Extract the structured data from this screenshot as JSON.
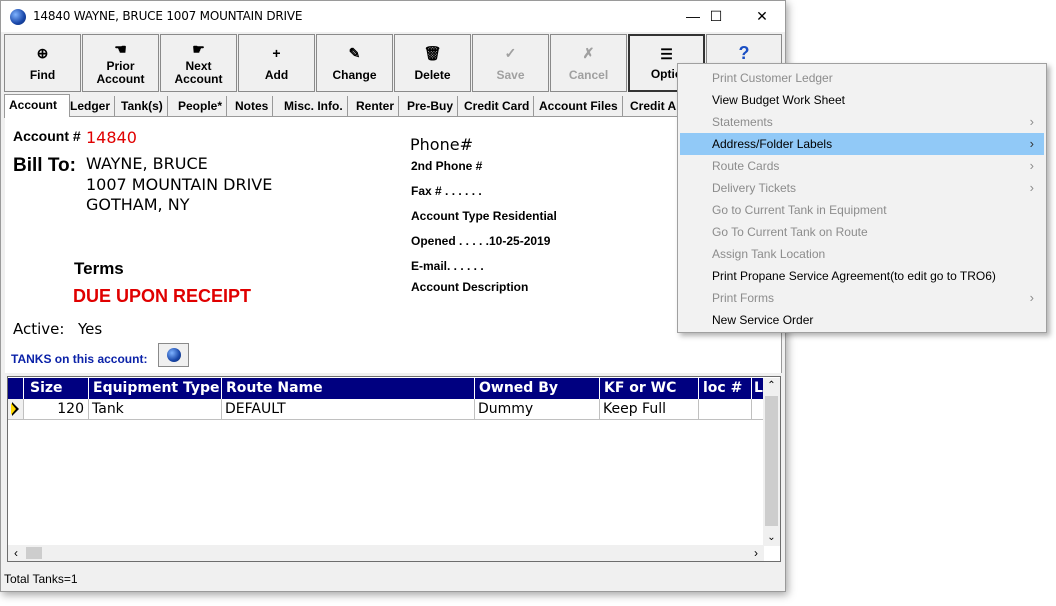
{
  "window": {
    "title": "14840 WAYNE, BRUCE 1007 MOUNTAIN DRIVE"
  },
  "window_controls": {
    "minimize": "—",
    "maximize": "☐",
    "close": "✕"
  },
  "toolbar": [
    {
      "id": "find",
      "label": "Find",
      "icon": "⊕",
      "enabled": true
    },
    {
      "id": "prior",
      "label": "Prior\nAccount",
      "icon": "☚",
      "enabled": true
    },
    {
      "id": "next",
      "label": "Next\nAccount",
      "icon": "☛",
      "enabled": true
    },
    {
      "id": "add",
      "label": "Add",
      "icon": "+",
      "enabled": true
    },
    {
      "id": "change",
      "label": "Change",
      "icon": "✎",
      "enabled": true
    },
    {
      "id": "delete",
      "label": "Delete",
      "icon": "🗑",
      "enabled": true
    },
    {
      "id": "save",
      "label": "Save",
      "icon": "✓",
      "enabled": false
    },
    {
      "id": "cancel",
      "label": "Cancel",
      "icon": "✗",
      "enabled": false
    },
    {
      "id": "options",
      "label": "Optio",
      "icon": "☰",
      "enabled": true
    },
    {
      "id": "help",
      "label": "",
      "icon": "?",
      "enabled": true
    }
  ],
  "tabs": [
    "Account",
    "Ledger",
    "Tank(s)",
    "People*",
    "Notes",
    "Misc. Info.",
    "Renter",
    "Pre-Buy",
    "Credit Card",
    "Account Files",
    "Credit Ap"
  ],
  "account": {
    "number_label": "Account #",
    "number": "14840",
    "bill_to_label": "Bill To:",
    "name": "WAYNE, BRUCE",
    "address1": "1007 MOUNTAIN DRIVE",
    "address2": "GOTHAM, NY",
    "terms_label": "Terms",
    "terms": "DUE UPON RECEIPT",
    "active_label": "Active:",
    "active": "Yes",
    "tanks_label": "TANKS on this account:"
  },
  "contact": {
    "phone": "Phone#",
    "phone2": "2nd Phone #",
    "fax": "Fax # . . . . . .",
    "account_type": "Account Type  Residential",
    "opened": "Opened . . . . .10-25-2019",
    "email": "E-mail. . . . . .",
    "description": "Account Description"
  },
  "grid": {
    "columns": [
      "Size",
      "Equipment Type",
      "Route Name",
      "Owned By",
      "KF or WC",
      "loc #",
      "L"
    ],
    "rows": [
      {
        "size": "120",
        "equipment_type": "Tank",
        "route_name": "DEFAULT",
        "owned_by": "Dummy",
        "kf_or_wc": "Keep Full",
        "loc": ""
      }
    ]
  },
  "status": {
    "text": "Total Tanks=1"
  },
  "menu": [
    {
      "label": "Print Customer Ledger",
      "enabled": false,
      "submenu": false,
      "highlighted": false
    },
    {
      "label": "View Budget Work Sheet",
      "enabled": true,
      "submenu": false,
      "highlighted": false
    },
    {
      "label": "Statements",
      "enabled": false,
      "submenu": true,
      "highlighted": false
    },
    {
      "label": "Address/Folder Labels",
      "enabled": true,
      "submenu": true,
      "highlighted": true
    },
    {
      "label": "Route Cards",
      "enabled": false,
      "submenu": true,
      "highlighted": false
    },
    {
      "label": "Delivery Tickets",
      "enabled": false,
      "submenu": true,
      "highlighted": false
    },
    {
      "label": "Go to Current Tank in Equipment",
      "enabled": false,
      "submenu": false,
      "highlighted": false
    },
    {
      "label": "Go To Current Tank on Route",
      "enabled": false,
      "submenu": false,
      "highlighted": false
    },
    {
      "label": "Assign Tank Location",
      "enabled": false,
      "submenu": false,
      "highlighted": false
    },
    {
      "label": "Print Propane Service Agreement(to edit go to TRO6)",
      "enabled": true,
      "submenu": false,
      "highlighted": false
    },
    {
      "label": "Print Forms",
      "enabled": false,
      "submenu": true,
      "highlighted": false
    },
    {
      "label": "New Service Order",
      "enabled": true,
      "submenu": false,
      "highlighted": false
    }
  ],
  "colors": {
    "accent_red": "#e00000",
    "header_navy": "#000080",
    "menu_highlight": "#91c9f7"
  }
}
